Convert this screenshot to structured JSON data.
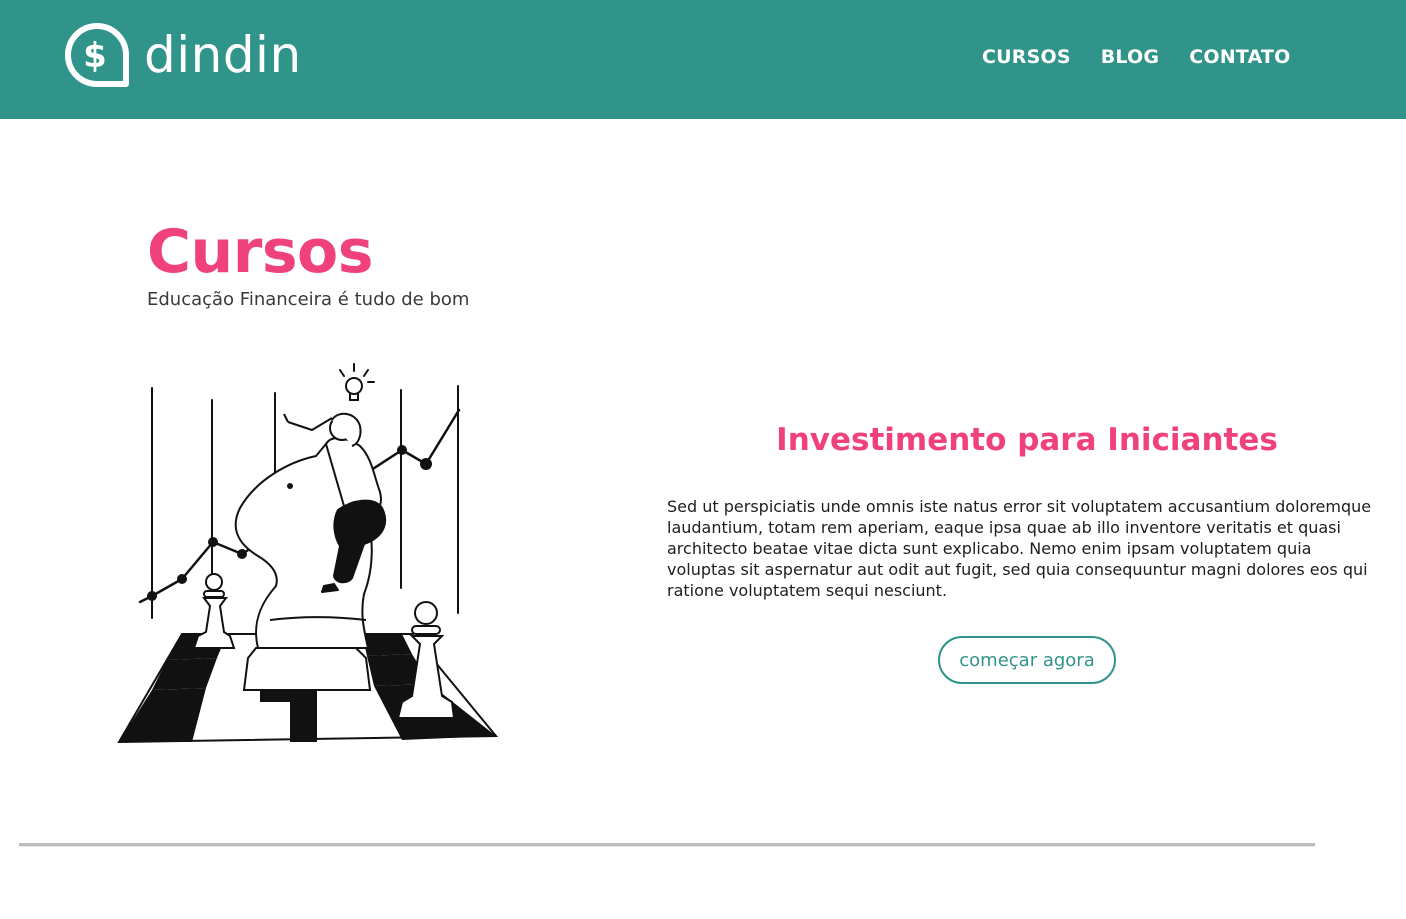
{
  "brand": {
    "name": "dindin",
    "icon": "dollar-chat-bubble-icon"
  },
  "nav": {
    "items": [
      {
        "label": "CURSOS"
      },
      {
        "label": "BLOG"
      },
      {
        "label": "CONTATO"
      }
    ]
  },
  "page": {
    "title": "Cursos",
    "subtitle": "Educação Financeira é tudo de bom"
  },
  "course": {
    "title": "Investimento para Iniciantes",
    "description": "Sed ut perspiciatis unde omnis iste natus error sit voluptatem accusantium doloremque laudantium, totam rem aperiam, eaque ipsa quae ab illo inventore veritatis et quasi architecto beatae vitae dicta sunt explicabo. Nemo enim ipsam voluptatem quia voluptas sit aspernatur aut odit aut fugit, sed quia consequuntur magni dolores eos qui ratione voluptatem sequi nesciunt.",
    "cta_label": "começar agora",
    "illustration": "chess-knight-rider-growth-chart-illustration"
  },
  "colors": {
    "header_bg": "#30948a",
    "accent_pink": "#f0417f",
    "button_border": "#30948a"
  }
}
